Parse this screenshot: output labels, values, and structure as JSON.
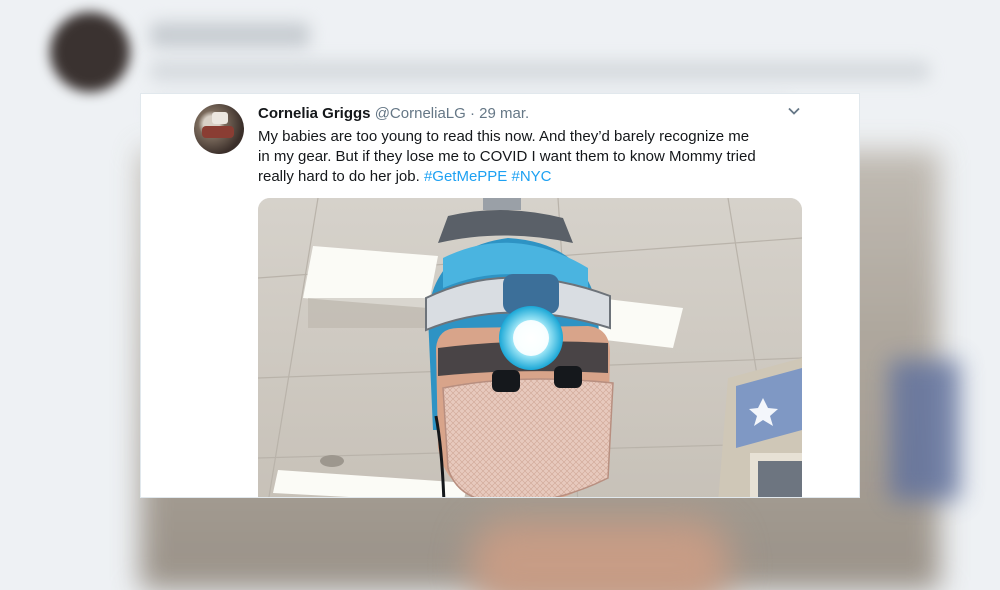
{
  "tweet": {
    "author_name": "Cornelia Griggs",
    "handle": "@CorneliaLG",
    "separator": "·",
    "date": "29 mar.",
    "text_lines": [
      "My babies are too young to read this now. And they’d barely recognize me",
      "in my gear. But if they lose me to COVID I want them to know Mommy tried",
      "really hard to do her job."
    ],
    "hashtags": [
      "#GetMePPE",
      "#NYC"
    ],
    "menu_icon": "chevron-down-icon",
    "photo_description_icon": "photo"
  },
  "colors": {
    "link": "#1da1f2",
    "text": "#14171a",
    "muted": "#657786",
    "light_blue": "#55dfff"
  }
}
